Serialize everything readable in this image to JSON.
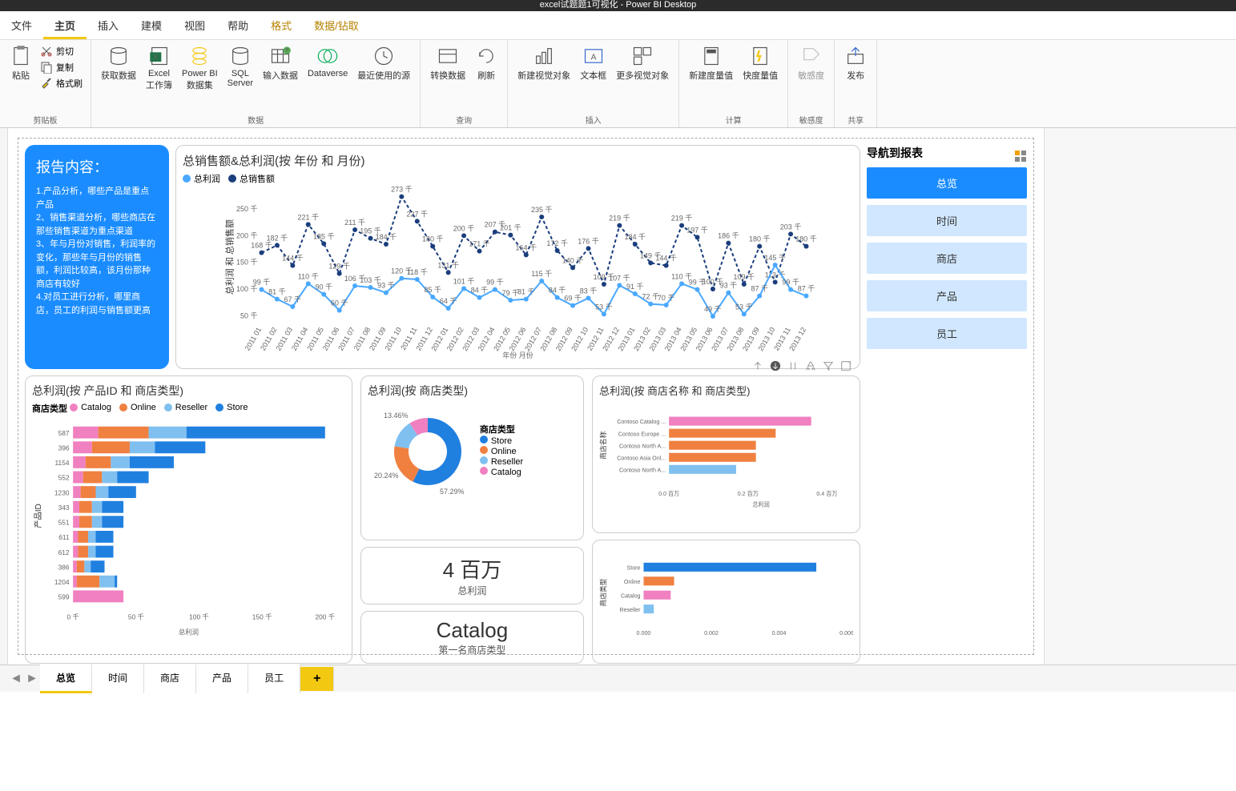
{
  "app": {
    "title": "excel试题题1可视化 - Power BI Desktop"
  },
  "menu_tabs": [
    "文件",
    "主页",
    "插入",
    "建模",
    "视图",
    "帮助",
    "格式",
    "数据/钻取"
  ],
  "menu_tabs_selected": 1,
  "menu_tabs_yellow": [
    6,
    7
  ],
  "ribbon": {
    "clipboard": {
      "paste": "粘贴",
      "cut": "剪切",
      "copy": "复制",
      "format": "格式刷",
      "group": "剪贴板"
    },
    "data": {
      "get": "获取数据",
      "excel": "Excel\n工作簿",
      "pbi": "Power BI\n数据集",
      "sql": "SQL\nServer",
      "input": "输入数据",
      "dataverse": "Dataverse",
      "recent": "最近使用的源",
      "group": "数据"
    },
    "query": {
      "transform": "转换数据",
      "refresh": "刷新",
      "group": "查询"
    },
    "insert": {
      "newvis": "新建视觉对象",
      "textbox": "文本框",
      "morevis": "更多视觉对象",
      "group": "插入"
    },
    "calc": {
      "newmeasure": "新建度量值",
      "quickmeasure": "快度量值",
      "group": "计算"
    },
    "sensitivity": {
      "label": "敏感度",
      "group": "敏感度"
    },
    "share": {
      "publish": "发布",
      "group": "共享"
    }
  },
  "info_card": {
    "title": "报告内容：",
    "body": "1.产品分析，哪些产品是重点产品\n2、销售渠道分析，哪些商店在那些销售渠道为重点渠道\n3、年与月份对销售，利润率的变化，那些年与月份的销售额，利润比较高，该月份那种商店有较好\n4.对员工进行分析，哪里商店，员工的利润与销售额更高"
  },
  "nav": {
    "title": "导航到报表",
    "items": [
      "总览",
      "时间",
      "商店",
      "产品",
      "员工"
    ],
    "active": 0
  },
  "line_chart": {
    "title": "总销售额&总利润(按 年份 和 月份)",
    "legend": [
      {
        "label": "总利润",
        "color": "#4aa8ff"
      },
      {
        "label": "总销售额",
        "color": "#1a3d7c"
      }
    ],
    "y_axis_title": "总利润 和 总销售额",
    "x_axis_title": "年份 月份"
  },
  "bar_chart": {
    "title": "总利润(按 产品ID 和 商店类型)",
    "legend_title": "商店类型",
    "legend": [
      {
        "label": "Catalog",
        "color": "#f080c0"
      },
      {
        "label": "Online",
        "color": "#f08040"
      },
      {
        "label": "Reseller",
        "color": "#80c0f0"
      },
      {
        "label": "Store",
        "color": "#2080e0"
      }
    ],
    "y_axis_title": "产品ID",
    "x_axis_title": "总利润"
  },
  "donut": {
    "title": "总利润(按 商店类型)",
    "legend_title": "商店类型",
    "legend": [
      {
        "label": "Store",
        "color": "#2080e0"
      },
      {
        "label": "Online",
        "color": "#f08040"
      },
      {
        "label": "Reseller",
        "color": "#80c0f0"
      },
      {
        "label": "Catalog",
        "color": "#f080c0"
      }
    ],
    "labels": {
      "store": "57.29%",
      "online": "20.24%",
      "reseller": "13.46%"
    }
  },
  "kpi1": {
    "value": "4 百万",
    "label": "总利润"
  },
  "kpi2": {
    "value": "Catalog",
    "label": "第一名商店类型"
  },
  "hbar1": {
    "title": "总利润(按 商店名称 和 商店类型)",
    "y_axis_title": "商店名称",
    "x_axis_title": "总利润"
  },
  "hbar2": {
    "y_axis_title": "商店类型"
  },
  "page_tabs": [
    "总览",
    "时间",
    "商店",
    "产品",
    "员工"
  ],
  "page_tabs_active": 0,
  "chart_data": [
    {
      "type": "line",
      "id": "line_chart",
      "title": "总销售额&总利润(按 年份 和 月份)",
      "xlabel": "年份 月份",
      "ylabel": "总利润 和 总销售额",
      "x": [
        "2011 01",
        "2011 02",
        "2011 03",
        "2011 04",
        "2011 05",
        "2011 06",
        "2011 07",
        "2011 08",
        "2011 09",
        "2011 10",
        "2011 11",
        "2011 12",
        "2012 01",
        "2012 02",
        "2012 03",
        "2012 04",
        "2012 05",
        "2012 06",
        "2012 07",
        "2012 08",
        "2012 09",
        "2012 10",
        "2012 11",
        "2012 12",
        "2013 01",
        "2013 02",
        "2013 03",
        "2013 04",
        "2013 05",
        "2013 06",
        "2013 07",
        "2013 08",
        "2013 09",
        "2013 10",
        "2013 11",
        "2013 12"
      ],
      "series": [
        {
          "name": "总销售额",
          "color": "#1a3d7c",
          "unit": "千",
          "values": [
            168,
            182,
            144,
            221,
            185,
            129,
            211,
            195,
            184,
            273,
            227,
            180,
            131,
            200,
            171,
            207,
            201,
            164,
            235,
            172,
            140,
            176,
            109,
            219,
            184,
            149,
            144,
            219,
            197,
            100,
            186,
            109,
            180,
            113,
            203,
            180
          ]
        },
        {
          "name": "总利润",
          "color": "#4aa8ff",
          "unit": "千",
          "values": [
            99,
            81,
            67,
            110,
            90,
            60,
            106,
            103,
            93,
            120,
            118,
            85,
            64,
            101,
            84,
            99,
            79,
            81,
            115,
            84,
            69,
            83,
            53,
            107,
            91,
            72,
            70,
            110,
            99,
            49,
            93,
            53,
            87,
            145,
            99,
            87
          ]
        }
      ],
      "y_ticks": [
        50,
        100,
        150,
        200,
        250
      ],
      "y_unit": "千"
    },
    {
      "type": "bar",
      "id": "bar_chart",
      "orientation": "horizontal",
      "stacked": true,
      "title": "总利润(按 产品ID 和 商店类型)",
      "xlabel": "总利润",
      "ylabel": "产品ID",
      "categories": [
        "587",
        "396",
        "1154",
        "552",
        "1230",
        "343",
        "551",
        "611",
        "612",
        "386",
        "1204",
        "599"
      ],
      "series": [
        {
          "name": "Catalog",
          "color": "#f080c0",
          "values": [
            20,
            15,
            10,
            8,
            6,
            5,
            5,
            4,
            4,
            3,
            3,
            40
          ]
        },
        {
          "name": "Online",
          "color": "#f08040",
          "values": [
            40,
            30,
            20,
            15,
            12,
            10,
            10,
            8,
            8,
            6,
            18,
            0
          ]
        },
        {
          "name": "Reseller",
          "color": "#80c0f0",
          "values": [
            30,
            20,
            15,
            12,
            10,
            8,
            8,
            6,
            6,
            5,
            12,
            0
          ]
        },
        {
          "name": "Store",
          "color": "#2080e0",
          "values": [
            110,
            40,
            35,
            25,
            22,
            17,
            17,
            14,
            14,
            11,
            2,
            0
          ]
        }
      ],
      "x_ticks": [
        0,
        50,
        100,
        150,
        200
      ],
      "x_unit": "千"
    },
    {
      "type": "pie",
      "id": "donut",
      "title": "总利润(按 商店类型)",
      "series": [
        {
          "name": "商店类型",
          "values": [
            {
              "label": "Store",
              "value": 57.29,
              "color": "#2080e0"
            },
            {
              "label": "Online",
              "value": 20.24,
              "color": "#f08040"
            },
            {
              "label": "Reseller",
              "value": 13.46,
              "color": "#80c0f0"
            },
            {
              "label": "Catalog",
              "value": 9.01,
              "color": "#f080c0"
            }
          ]
        }
      ]
    },
    {
      "type": "bar",
      "id": "hbar1",
      "orientation": "horizontal",
      "title": "总利润(按 商店名称 和 商店类型)",
      "xlabel": "总利润",
      "ylabel": "商店名称",
      "categories": [
        "Contoso Catalog ...",
        "Contoso Europe ...",
        "Contoso North A...",
        "Contoso Asia Onl...",
        "Contoso North A..."
      ],
      "values": [
        0.36,
        0.27,
        0.22,
        0.22,
        0.17
      ],
      "colors": [
        "#f080c0",
        "#f08040",
        "#f08040",
        "#f08040",
        "#80c0f0"
      ],
      "x_ticks": [
        0.0,
        0.2,
        0.4
      ],
      "x_unit": "百万"
    },
    {
      "type": "bar",
      "id": "hbar2",
      "orientation": "horizontal",
      "ylabel": "商店类型",
      "categories": [
        "Store",
        "Online",
        "Catalog",
        "Reseller"
      ],
      "values": [
        0.0051,
        0.0009,
        0.0008,
        0.0003
      ],
      "colors": [
        "#2080e0",
        "#f08040",
        "#f080c0",
        "#80c0f0"
      ],
      "x_ticks": [
        0.0,
        0.002,
        0.004,
        0.006
      ]
    }
  ]
}
